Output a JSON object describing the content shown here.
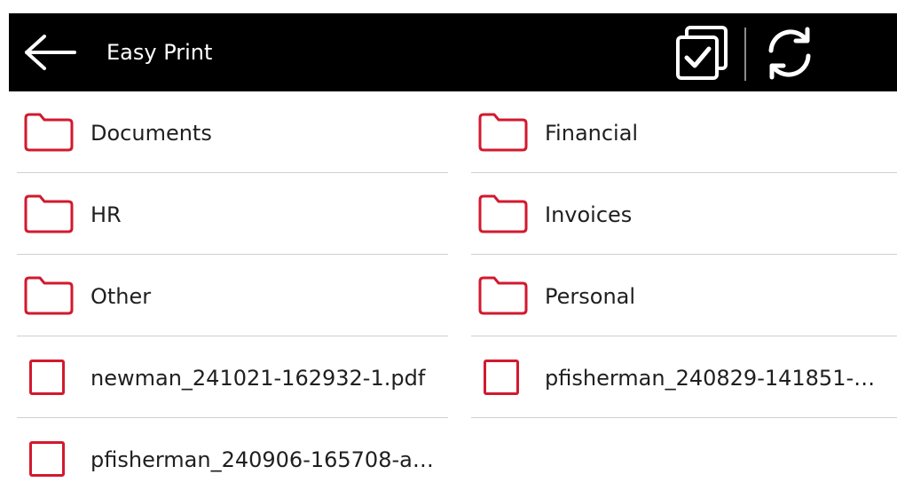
{
  "header": {
    "title": "Easy Print",
    "back_icon": "arrow-left-icon",
    "select_all_icon": "select-all-checkbox-icon",
    "refresh_icon": "refresh-icon"
  },
  "colors": {
    "header_background": "#000000",
    "header_text": "#ffffff",
    "accent": "#d2192e",
    "text": "#1f1f1f",
    "separator": "#d0d0d0"
  },
  "items": [
    {
      "label": "Documents",
      "type": "folder",
      "icon": "folder-icon"
    },
    {
      "label": "Financial",
      "type": "folder",
      "icon": "folder-icon"
    },
    {
      "label": "HR",
      "type": "folder",
      "icon": "folder-icon"
    },
    {
      "label": "Invoices",
      "type": "folder",
      "icon": "folder-icon"
    },
    {
      "label": "Other",
      "type": "folder",
      "icon": "folder-icon"
    },
    {
      "label": "Personal",
      "type": "folder",
      "icon": "folder-icon"
    },
    {
      "label": "newman_241021-162932-1.pdf",
      "type": "file",
      "icon": "checkbox-icon",
      "checked": false
    },
    {
      "label": "pfisherman_240829-141851-…",
      "type": "file",
      "icon": "checkbox-icon",
      "checked": false
    },
    {
      "label": "pfisherman_240906-165708-a…",
      "type": "file",
      "icon": "checkbox-icon",
      "checked": false
    }
  ]
}
